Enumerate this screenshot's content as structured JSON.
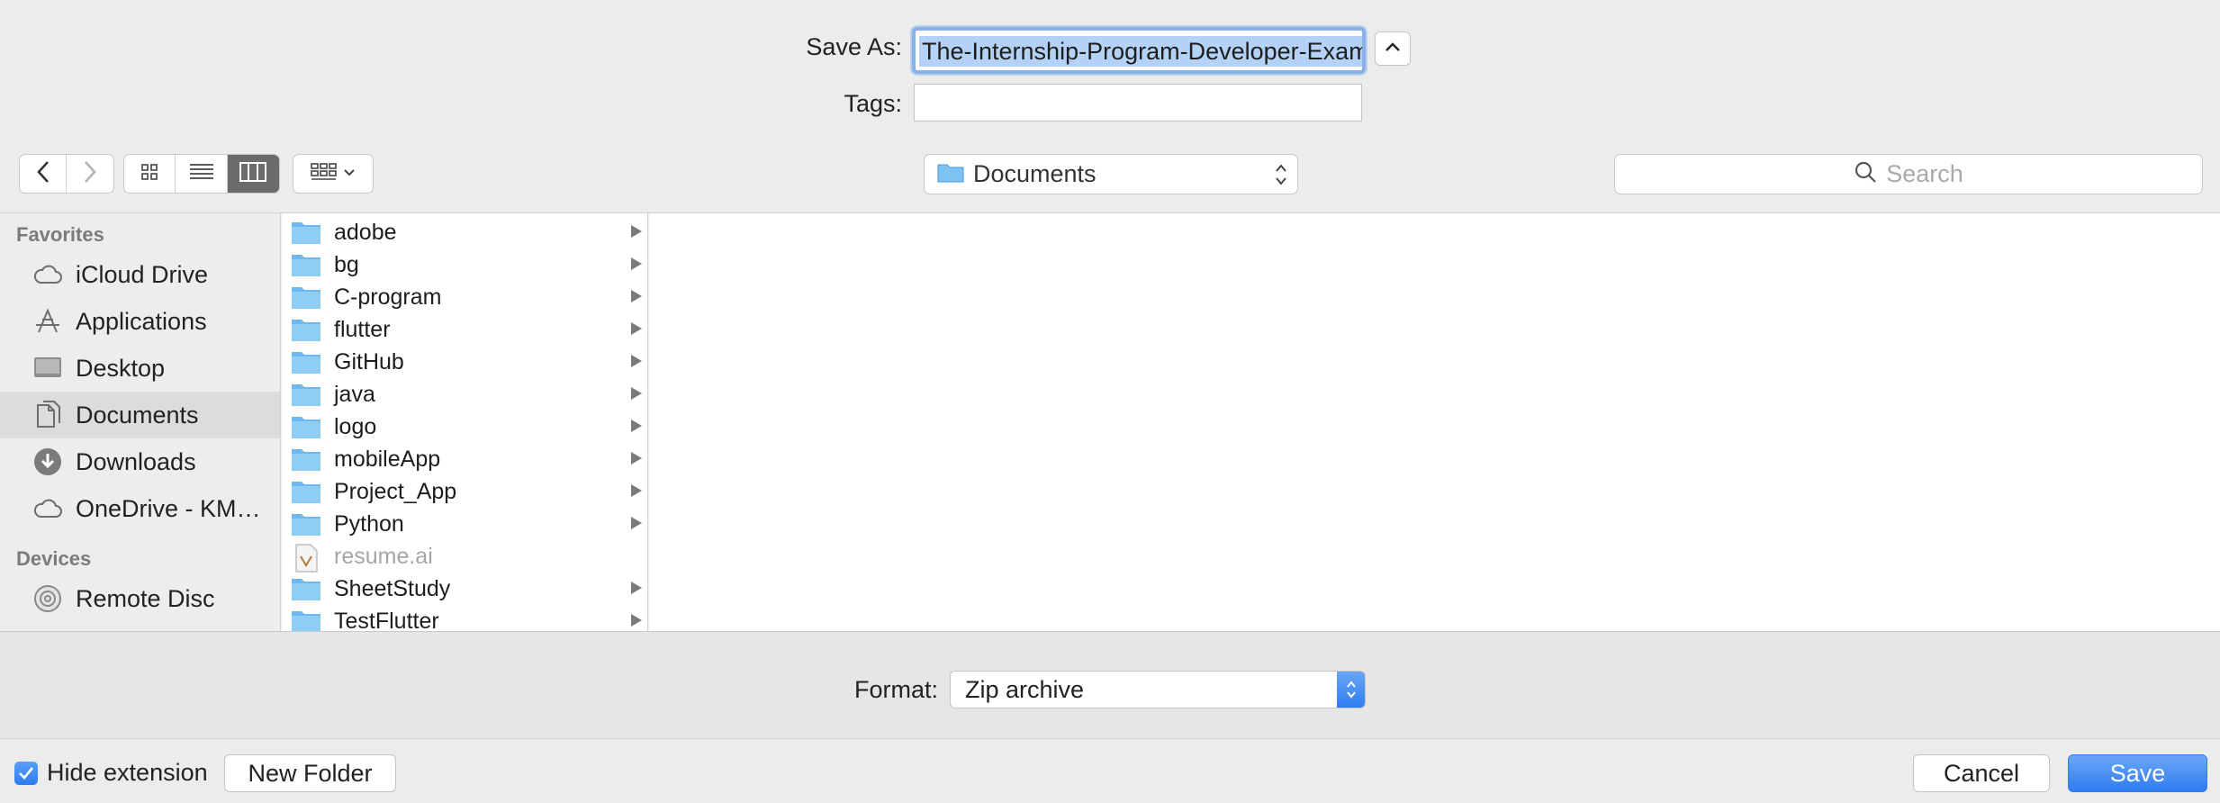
{
  "dialog": {
    "save_as_label": "Save As:",
    "save_as_value": "The-Internship-Program-Developer-Exam",
    "tags_label": "Tags:",
    "tags_value": ""
  },
  "toolbar": {
    "location": "Documents",
    "search_placeholder": "Search"
  },
  "sidebar": {
    "favorites_header": "Favorites",
    "favorites": [
      {
        "label": "iCloud Drive",
        "icon": "cloud-icon"
      },
      {
        "label": "Applications",
        "icon": "applications-icon"
      },
      {
        "label": "Desktop",
        "icon": "desktop-icon"
      },
      {
        "label": "Documents",
        "icon": "documents-icon",
        "selected": true
      },
      {
        "label": "Downloads",
        "icon": "downloads-icon"
      },
      {
        "label": "OneDrive - KM…",
        "icon": "cloud-icon"
      }
    ],
    "devices_header": "Devices",
    "devices": [
      {
        "label": "Remote Disc",
        "icon": "disc-icon"
      }
    ]
  },
  "files": [
    {
      "name": "adobe",
      "type": "folder"
    },
    {
      "name": "bg",
      "type": "folder"
    },
    {
      "name": "C-program",
      "type": "folder"
    },
    {
      "name": "flutter",
      "type": "folder"
    },
    {
      "name": "GitHub",
      "type": "folder"
    },
    {
      "name": "java",
      "type": "folder"
    },
    {
      "name": "logo",
      "type": "folder"
    },
    {
      "name": "mobileApp",
      "type": "folder"
    },
    {
      "name": "Project_App",
      "type": "folder"
    },
    {
      "name": "Python",
      "type": "folder"
    },
    {
      "name": "resume.ai",
      "type": "file"
    },
    {
      "name": "SheetStudy",
      "type": "folder"
    },
    {
      "name": "TestFlutter",
      "type": "folder"
    }
  ],
  "format": {
    "label": "Format:",
    "value": "Zip archive"
  },
  "footer": {
    "hide_extension_label": "Hide extension",
    "hide_extension_checked": true,
    "new_folder_label": "New Folder",
    "cancel_label": "Cancel",
    "save_label": "Save"
  },
  "colors": {
    "accent": "#2f7cf0",
    "folder": "#6db8ee",
    "selection": "#b4d2f5"
  }
}
